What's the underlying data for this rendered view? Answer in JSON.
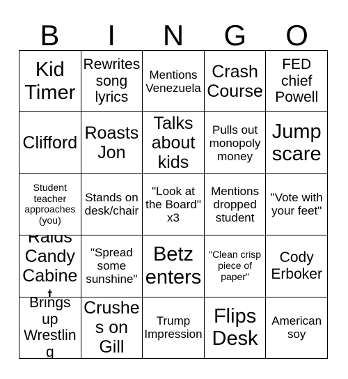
{
  "card": {
    "header": {
      "letters": [
        "B",
        "I",
        "N",
        "G",
        "O"
      ]
    },
    "rows": [
      [
        {
          "text": "Kid Timer",
          "size": "fs-xl"
        },
        {
          "text": "Rewrites song lyrics",
          "size": "fs-md"
        },
        {
          "text": "Mentions Venezuela",
          "size": "fs-sm"
        },
        {
          "text": "Crash Course",
          "size": "fs-lg"
        },
        {
          "text": "FED chief Powell",
          "size": "fs-md"
        }
      ],
      [
        {
          "text": "Clifford",
          "size": "fs-lg"
        },
        {
          "text": "Roasts Jon",
          "size": "fs-lg"
        },
        {
          "text": "Talks about kids",
          "size": "fs-lg"
        },
        {
          "text": "Pulls out monopoly money",
          "size": "fs-sm"
        },
        {
          "text": "Jump scare",
          "size": "fs-xl"
        }
      ],
      [
        {
          "text": "Student teacher approaches (you)",
          "size": "fs-xs"
        },
        {
          "text": "Stands on desk/chair",
          "size": "fs-sm"
        },
        {
          "text": "\"Look at the Board\" x3",
          "size": "fs-sm"
        },
        {
          "text": "Mentions dropped student",
          "size": "fs-sm"
        },
        {
          "text": "\"Vote with your feet\"",
          "size": "fs-sm"
        }
      ],
      [
        {
          "text": "Raids Candy Cabinet",
          "size": "fs-lg"
        },
        {
          "text": "\"Spread some sunshine\"",
          "size": "fs-sm"
        },
        {
          "text": "Betz enters",
          "size": "fs-xl"
        },
        {
          "text": "\"Clean crisp piece of paper\"",
          "size": "fs-xs"
        },
        {
          "text": "Cody Erboker",
          "size": "fs-md"
        }
      ],
      [
        {
          "text": "Brings up Wrestling",
          "size": "fs-md"
        },
        {
          "text": "Crushes on Gill",
          "size": "fs-lg"
        },
        {
          "text": "Trump Impression",
          "size": "fs-sm"
        },
        {
          "text": "Flips Desk",
          "size": "fs-xl"
        },
        {
          "text": "American soy",
          "size": "fs-sm"
        }
      ]
    ]
  },
  "colors": {
    "background": "#ffffff",
    "text": "#000000",
    "grid_line": "#000000"
  }
}
